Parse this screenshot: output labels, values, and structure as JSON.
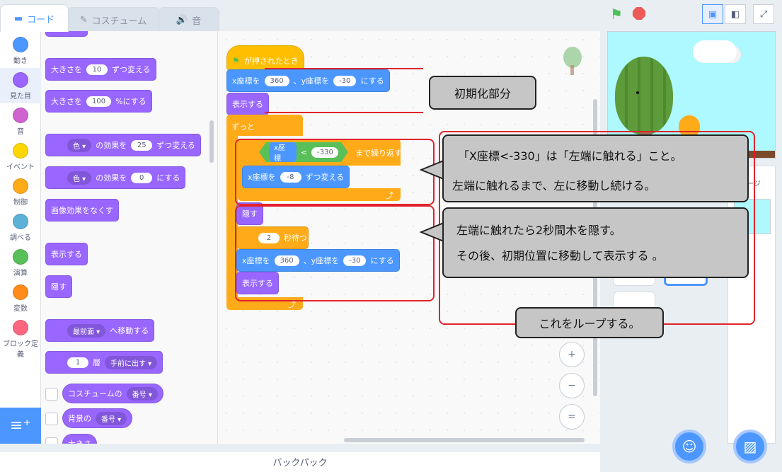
{
  "tabs": [
    {
      "label": "コード",
      "active": true
    },
    {
      "label": "コスチューム",
      "active": false
    },
    {
      "label": "音",
      "active": false
    }
  ],
  "categories": [
    {
      "label": "動き",
      "color": "#4c97ff"
    },
    {
      "label": "見た目",
      "color": "#9966ff"
    },
    {
      "label": "音",
      "color": "#cf63cf"
    },
    {
      "label": "イベント",
      "color": "#ffd500"
    },
    {
      "label": "制御",
      "color": "#ffab19"
    },
    {
      "label": "調べる",
      "color": "#5cb1d6"
    },
    {
      "label": "演算",
      "color": "#59c059"
    },
    {
      "label": "変数",
      "color": "#ff8c1a"
    },
    {
      "label": "ブロック定義",
      "color": "#ff6680"
    }
  ],
  "palette": {
    "size_change": {
      "pre": "大きさを",
      "val": "10",
      "post": "ずつ変える"
    },
    "size_set": {
      "pre": "大きさを",
      "val": "100",
      "post": "%にする"
    },
    "effect_change": {
      "dd": "色",
      "mid": "の効果を",
      "val": "25",
      "post": "ずつ変える"
    },
    "effect_set": {
      "dd": "色",
      "mid": "の効果を",
      "val": "0",
      "post": "にする"
    },
    "clear_effects": "画像効果をなくす",
    "show": "表示する",
    "hide": "隠す",
    "goto_front": {
      "dd": "最前面",
      "post": "へ移動する"
    },
    "go_layers": {
      "val": "1",
      "mid": "層",
      "dd": "手前に出す"
    },
    "costume_num": {
      "pre": "コスチュームの",
      "dd": "番号"
    },
    "backdrop_num": {
      "pre": "背景の",
      "dd": "番号"
    },
    "size_reporter": "大きさ"
  },
  "script": {
    "hat": "が押されたとき",
    "goto": {
      "a": "x座標を",
      "x": "360",
      "b": "、y座標を",
      "y": "-30",
      "c": "にする"
    },
    "show": "表示する",
    "forever": "ずっと",
    "repeat_until": {
      "reporter": "x座標",
      "op": "<",
      "val": "-330",
      "post": "まで繰り返す"
    },
    "change_x": {
      "a": "x座標を",
      "val": "-8",
      "b": "ずつ変える"
    },
    "hide": "隠す",
    "wait": {
      "val": "2",
      "post": "秒待つ"
    },
    "goto2": {
      "a": "x座標を",
      "x": "360",
      "b": "、y座標を",
      "y": "-30",
      "c": "にする"
    },
    "show2": "表示する"
  },
  "notes": {
    "init": "初期化部分",
    "loop_line1": "「X座標<-330」は「左端に触れる」こと。",
    "loop_line2": "左端に触れるまで、左に移動し続ける。",
    "hide_line1": "左端に触れたら2秒間木を隠す。",
    "hide_line2": "その後、初期位置に移動して表示する 。",
    "repeat": "これをループする。"
  },
  "zoom": {
    "in": "+",
    "out": "−",
    "reset": "="
  },
  "backpack": "バックパック",
  "stage_panel_label": "ージ",
  "colors": {
    "accent": "#4c97ff",
    "annotation_red": "#e2232b"
  }
}
